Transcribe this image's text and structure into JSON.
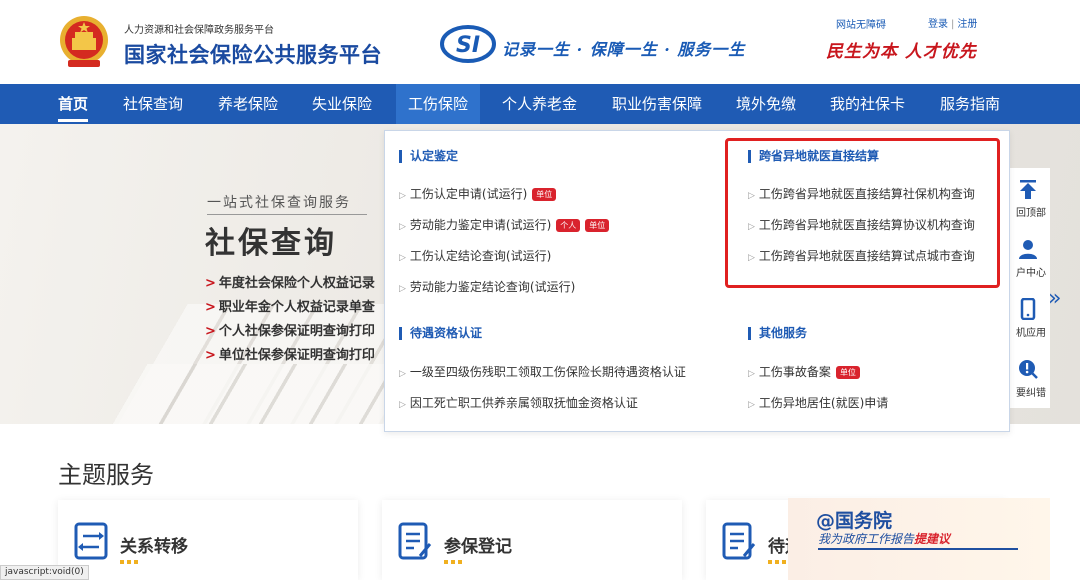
{
  "header": {
    "org_small": "人力资源和社会保障政务服务平台",
    "org_big": "国家社会保险公共服务平台",
    "si_logo": "SI",
    "slogan": "记录一生 · 保障一生 · 服务一生",
    "accessible": "网站无障碍",
    "login": "登录",
    "register": "注册",
    "red_slogan": "民生为本 人才优先"
  },
  "nav": {
    "items": [
      {
        "label": "首页"
      },
      {
        "label": "社保查询"
      },
      {
        "label": "养老保险"
      },
      {
        "label": "失业保险"
      },
      {
        "label": "工伤保险"
      },
      {
        "label": "个人养老金"
      },
      {
        "label": "职业伤害保障"
      },
      {
        "label": "境外免缴"
      },
      {
        "label": "我的社保卡"
      },
      {
        "label": "服务指南"
      }
    ]
  },
  "banner": {
    "subtitle": "一站式社保查询服务",
    "title": "社保查询",
    "items": [
      "年度社会保险个人权益记录",
      "职业年金个人权益记录单查",
      "个人社保参保证明查询打印",
      "单位社保参保证明查询打印"
    ]
  },
  "dropdown": {
    "sections": [
      {
        "title": "认定鉴定",
        "items": [
          {
            "label": "工伤认定申请(试运行)",
            "tags": [
              "单位"
            ]
          },
          {
            "label": "劳动能力鉴定申请(试运行)",
            "tags": [
              "个人",
              "单位"
            ]
          },
          {
            "label": "工伤认定结论查询(试运行)",
            "tags": []
          },
          {
            "label": "劳动能力鉴定结论查询(试运行)",
            "tags": []
          }
        ]
      },
      {
        "title": "跨省异地就医直接结算",
        "items": [
          {
            "label": "工伤跨省异地就医直接结算社保机构查询",
            "tags": []
          },
          {
            "label": "工伤跨省异地就医直接结算协议机构查询",
            "tags": []
          },
          {
            "label": "工伤跨省异地就医直接结算试点城市查询",
            "tags": []
          }
        ]
      },
      {
        "title": "待遇资格认证",
        "items": [
          {
            "label": "一级至四级伤残职工领取工伤保险长期待遇资格认证",
            "tags": []
          },
          {
            "label": "因工死亡职工供养亲属领取抚恤金资格认证",
            "tags": []
          }
        ]
      },
      {
        "title": "其他服务",
        "items": [
          {
            "label": "工伤事故备案",
            "tags": [
              "单位"
            ]
          },
          {
            "label": "工伤异地居住(就医)申请",
            "tags": []
          }
        ]
      }
    ]
  },
  "side": {
    "items": [
      {
        "label": "回顶部",
        "icon": "arrow-up-icon"
      },
      {
        "label": "户中心",
        "icon": "user-icon"
      },
      {
        "label": "机应用",
        "icon": "mobile-icon"
      },
      {
        "label": "要纠错",
        "icon": "alert-icon"
      }
    ]
  },
  "theme": {
    "title": "主题服务",
    "cards": [
      {
        "label": "关系转移",
        "icon": "transfer-icon"
      },
      {
        "label": "参保登记",
        "icon": "form-icon"
      },
      {
        "label": "待遇",
        "icon": "form-icon"
      }
    ]
  },
  "watermark": {
    "handle": "@国务院",
    "line_prefix": "我为政府工作报告",
    "line_highlight": "提建议"
  },
  "status": {
    "text": "javascript:void(0)"
  },
  "colors": {
    "nav_blue": "#1f5bb4",
    "brand_red": "#c8161d",
    "tag_red": "#d9232d",
    "highlight_box": "#e02020"
  }
}
